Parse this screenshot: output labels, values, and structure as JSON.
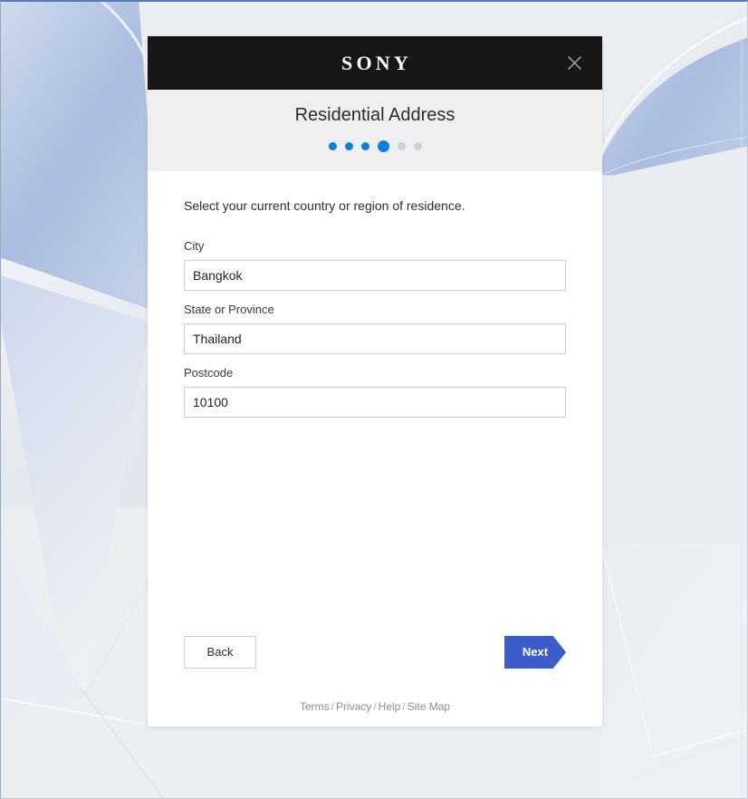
{
  "window": {
    "brand_logo": "SONY",
    "close_icon": "close-icon"
  },
  "header": {
    "title": "Residential Address",
    "progress": {
      "total_steps": 6,
      "current_step": 4,
      "completed_color": "#0b7fdb",
      "pending_color": "#c7d4de"
    }
  },
  "form": {
    "intro": "Select your current country or region of residence.",
    "fields": [
      {
        "label": "City",
        "value": "Bangkok",
        "placeholder": ""
      },
      {
        "label": "State or Province",
        "value": "Thailand",
        "placeholder": ""
      },
      {
        "label": "Postcode",
        "value": "10100",
        "placeholder": ""
      }
    ]
  },
  "actions": {
    "back_label": "Back",
    "next_label": "Next",
    "next_color": "#3d5ccc"
  },
  "footer": {
    "links": [
      "Terms",
      "Privacy",
      "Help",
      "Site Map"
    ],
    "separator": "/"
  },
  "background": {
    "base_color": "#eceff2",
    "accent_blue": "#aabddf",
    "light_panel": "#e6eaef"
  }
}
